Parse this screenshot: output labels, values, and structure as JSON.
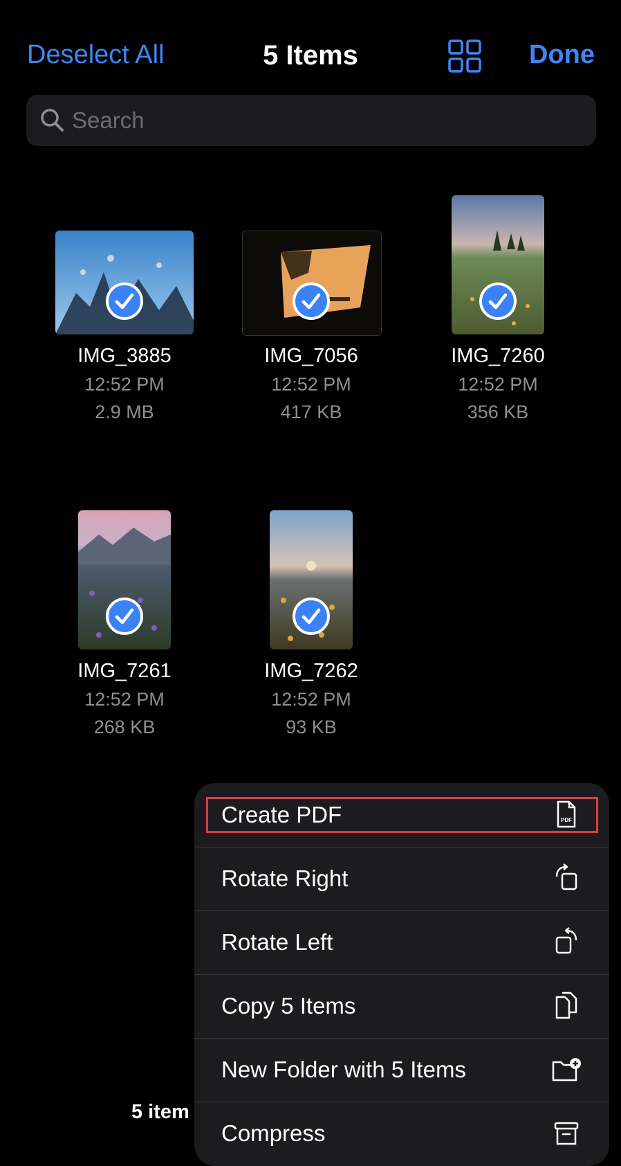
{
  "nav": {
    "deselect_label": "Deselect All",
    "title": "5 Items",
    "done_label": "Done",
    "accent": "#3f86f5"
  },
  "search": {
    "placeholder": "Search"
  },
  "files": [
    {
      "name": "IMG_3885",
      "time": "12:52 PM",
      "size": "2.9 MB",
      "selected": true
    },
    {
      "name": "IMG_7056",
      "time": "12:52 PM",
      "size": "417 KB",
      "selected": true
    },
    {
      "name": "IMG_7260",
      "time": "12:52 PM",
      "size": "356 KB",
      "selected": true
    },
    {
      "name": "IMG_7261",
      "time": "12:52 PM",
      "size": "268 KB",
      "selected": true
    },
    {
      "name": "IMG_7262",
      "time": "12:52 PM",
      "size": "93 KB",
      "selected": true
    }
  ],
  "footer": {
    "count": "5 item"
  },
  "menu": {
    "items": [
      {
        "label": "Create PDF",
        "icon": "pdf-document-icon",
        "highlighted": true
      },
      {
        "label": "Rotate Right",
        "icon": "rotate-right-icon"
      },
      {
        "label": "Rotate Left",
        "icon": "rotate-left-icon"
      },
      {
        "label": "Copy 5 Items",
        "icon": "copy-documents-icon"
      },
      {
        "label": "New Folder with 5 Items",
        "icon": "new-folder-icon"
      },
      {
        "label": "Compress",
        "icon": "archive-box-icon"
      }
    ],
    "highlight_color": "#e03a45"
  }
}
